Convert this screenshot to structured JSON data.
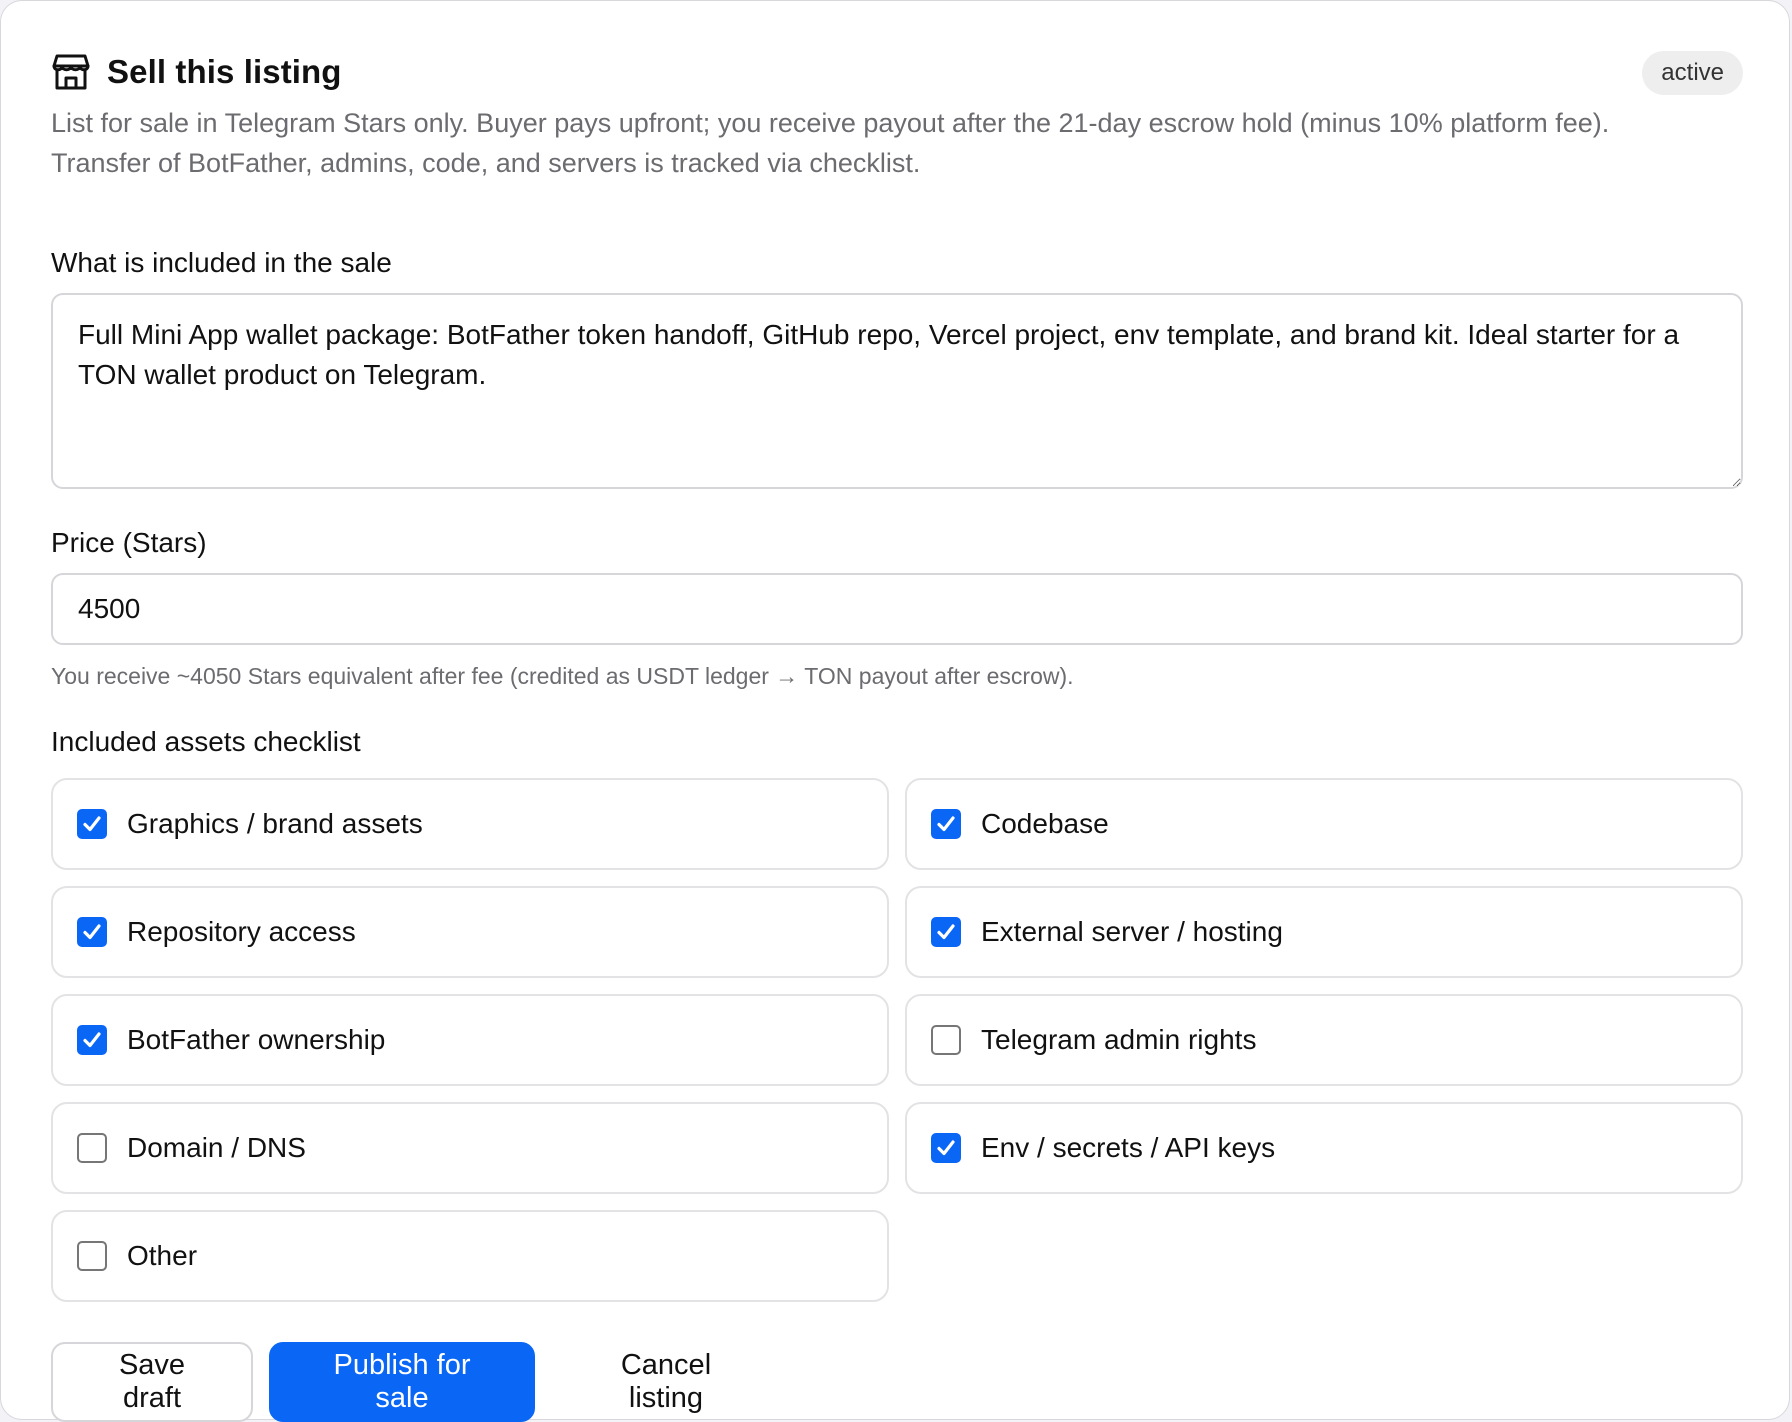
{
  "header": {
    "title": "Sell this listing",
    "status": "active",
    "icon": "storefront-icon"
  },
  "description": "List for sale in Telegram Stars only. Buyer pays upfront; you receive payout after the 21-day escrow hold (minus 10% platform fee). Transfer of BotFather, admins, code, and servers is tracked via checklist.",
  "included": {
    "label": "What is included in the sale",
    "value": "Full Mini App wallet package: BotFather token handoff, GitHub repo, Vercel project, env template, and brand kit. Ideal starter for a TON wallet product on Telegram."
  },
  "price": {
    "label": "Price (Stars)",
    "value": "4500",
    "hint": "You receive ~4050 Stars equivalent after fee (credited as USDT ledger → TON payout after escrow)."
  },
  "checklist": {
    "label": "Included assets checklist",
    "items": [
      {
        "label": "Graphics / brand assets",
        "checked": true
      },
      {
        "label": "Codebase",
        "checked": true
      },
      {
        "label": "Repository access",
        "checked": true
      },
      {
        "label": "External server / hosting",
        "checked": true
      },
      {
        "label": "BotFather ownership",
        "checked": true
      },
      {
        "label": "Telegram admin rights",
        "checked": false
      },
      {
        "label": "Domain / DNS",
        "checked": false
      },
      {
        "label": "Env / secrets / API keys",
        "checked": true
      },
      {
        "label": "Other",
        "checked": false
      }
    ]
  },
  "actions": {
    "save_draft": "Save draft",
    "publish": "Publish for sale",
    "cancel": "Cancel listing"
  },
  "colors": {
    "accent": "#0a66f5",
    "muted_text": "#6b6b70",
    "badge_bg": "#eeeeef"
  }
}
